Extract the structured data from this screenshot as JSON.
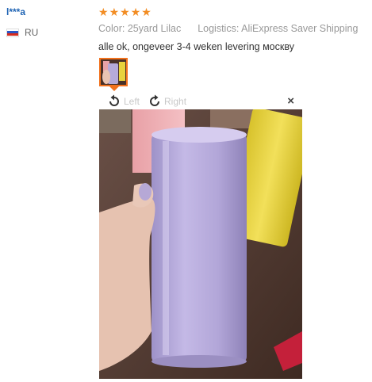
{
  "reviewer": {
    "name": "l***a",
    "country": "RU"
  },
  "review": {
    "rating": 5,
    "color_label": "Color:",
    "color_value": "25yard Lilac",
    "logistics_label": "Logistics:",
    "logistics_value": "AliExpress Saver Shipping",
    "text": "alle ok, ongeveer 3-4 weken levering москву"
  },
  "viewer": {
    "rotate_left_label": "Left",
    "rotate_right_label": "Right",
    "close_label": "×"
  },
  "colors": {
    "accent": "#f2711c",
    "star": "#f28d24",
    "username": "#1f64b4"
  }
}
